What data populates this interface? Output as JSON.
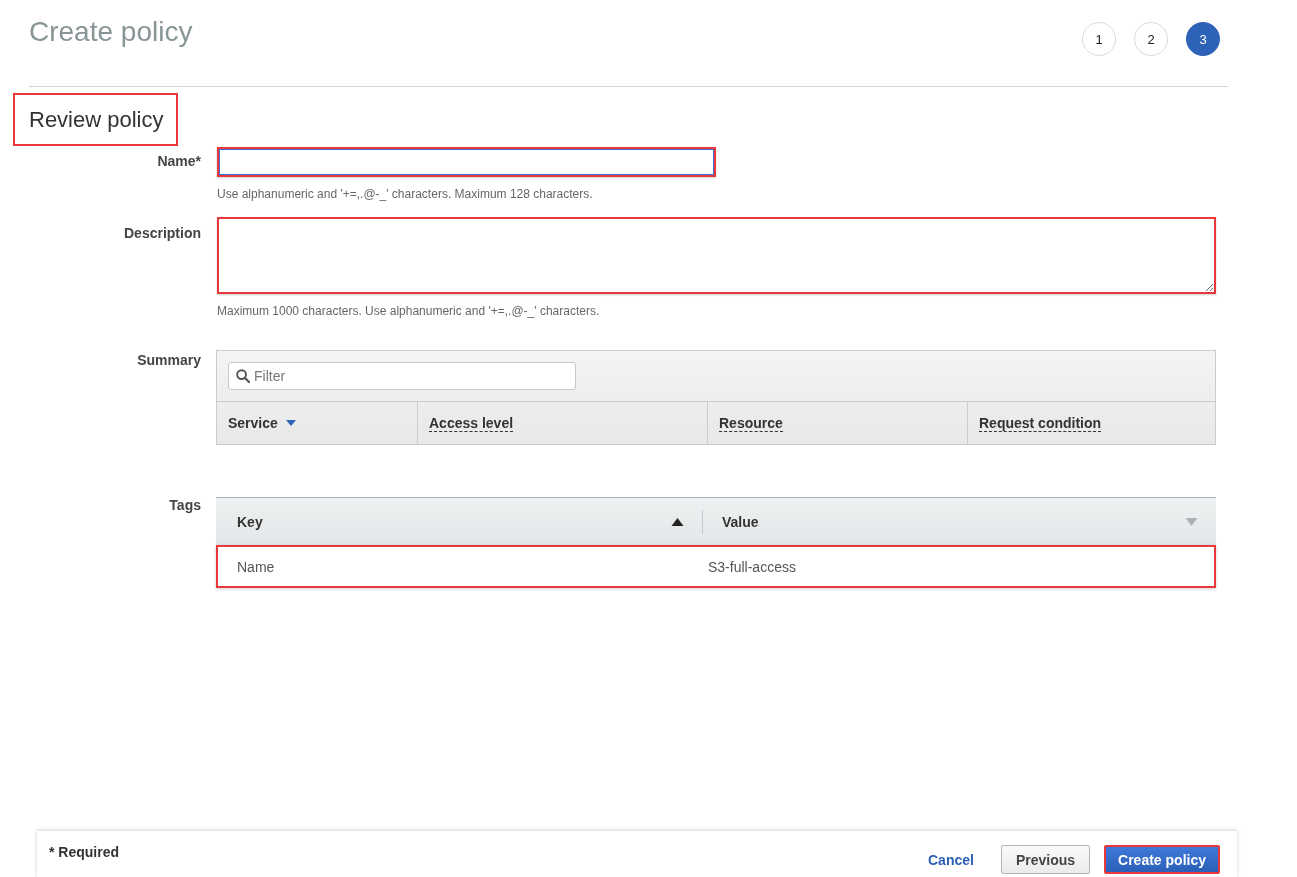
{
  "header": {
    "title": "Create policy",
    "steps": [
      {
        "label": "1",
        "selected": false
      },
      {
        "label": "2",
        "selected": false
      },
      {
        "label": "3",
        "selected": true
      }
    ]
  },
  "section": {
    "title": "Review policy",
    "highlighted": true
  },
  "name_field": {
    "label": "Name*",
    "hint": "Use alphanumeric and '+=,.@-_' characters. Maximum 128 characters.",
    "focused": true,
    "highlighted": true
  },
  "description_field": {
    "label": "Description",
    "hint": "Maximum 1000 characters. Use alphanumeric and '+=,.@-_' characters.",
    "focused": false,
    "highlighted": true
  },
  "summary": {
    "label": "Summary",
    "filter": {
      "placeholder": "Filter"
    },
    "columns": [
      {
        "label": "Service",
        "kind": "sort",
        "descending": true
      },
      {
        "label": "Access level",
        "kind": "help"
      },
      {
        "label": "Resource",
        "kind": "help"
      },
      {
        "label": "Request condition",
        "kind": "help"
      }
    ]
  },
  "tags": {
    "label": "Tags",
    "columns": [
      {
        "label": "Key",
        "ascending": true,
        "active": true
      },
      {
        "label": "Value",
        "ascending": false,
        "active": false
      }
    ],
    "rows": [
      {
        "key": "Name",
        "value": "S3-full-access",
        "highlighted": true
      }
    ]
  },
  "footer": {
    "note": "* Required",
    "buttons": [
      {
        "label": "Cancel",
        "kind": "link",
        "highlighted": false
      },
      {
        "label": "Previous",
        "kind": "secondary",
        "highlighted": false
      },
      {
        "label": "Create policy",
        "kind": "primary",
        "highlighted": true
      }
    ]
  }
}
